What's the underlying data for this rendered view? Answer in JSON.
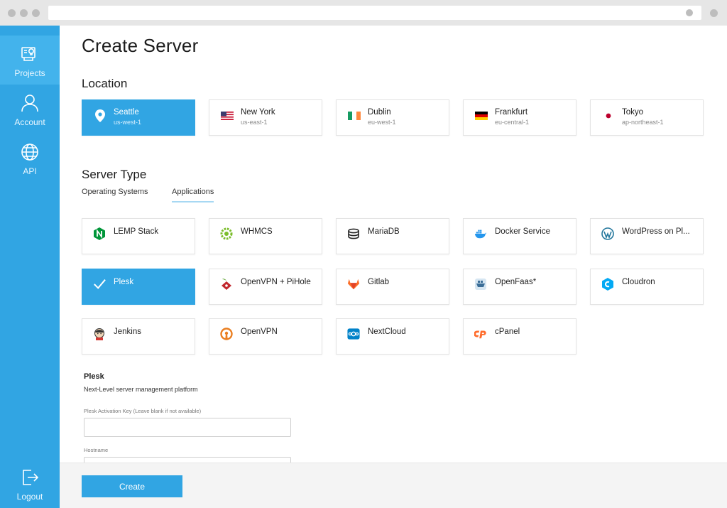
{
  "nav": {
    "projects": "Projects",
    "account": "Account",
    "api": "API",
    "logout": "Logout"
  },
  "page_title": "Create Server",
  "location_heading": "Location",
  "locations": [
    {
      "name": "Seattle",
      "code": "us-west-1",
      "selected": true
    },
    {
      "name": "New York",
      "code": "us-east-1"
    },
    {
      "name": "Dublin",
      "code": "eu-west-1"
    },
    {
      "name": "Frankfurt",
      "code": "eu-central-1"
    },
    {
      "name": "Tokyo",
      "code": "ap-northeast-1"
    }
  ],
  "server_type_heading": "Server Type",
  "tabs": [
    {
      "label": "Operating Systems"
    },
    {
      "label": "Applications",
      "active": true
    }
  ],
  "apps": [
    {
      "name": "LEMP Stack",
      "icon": "nginx-icon"
    },
    {
      "name": "WHMCS",
      "icon": "whmcs-icon"
    },
    {
      "name": "MariaDB",
      "icon": "mariadb-icon"
    },
    {
      "name": "Docker Service",
      "icon": "docker-icon"
    },
    {
      "name": "WordPress on Pl...",
      "icon": "wordpress-icon"
    },
    {
      "name": "Plesk",
      "icon": "check-icon",
      "selected": true
    },
    {
      "name": "OpenVPN + PiHole",
      "icon": "pihole-icon"
    },
    {
      "name": "Gitlab",
      "icon": "gitlab-icon"
    },
    {
      "name": "OpenFaas*",
      "icon": "openfaas-icon"
    },
    {
      "name": "Cloudron",
      "icon": "cloudron-icon"
    },
    {
      "name": "Jenkins",
      "icon": "jenkins-icon"
    },
    {
      "name": "OpenVPN",
      "icon": "openvpn-icon"
    },
    {
      "name": "NextCloud",
      "icon": "nextcloud-icon"
    },
    {
      "name": "cPanel",
      "icon": "cpanel-icon"
    }
  ],
  "selected_app": {
    "title": "Plesk",
    "description": "Next-Level server management platform"
  },
  "fields": {
    "activation_key_label": "Plesk Activation Key (Leave blank if not available)",
    "activation_key_value": "",
    "hostname_label": "Hostname",
    "hostname_value": ""
  },
  "create_label": "Create",
  "colors": {
    "accent": "#31a5e3",
    "sidebar_active": "#43b3ec"
  }
}
